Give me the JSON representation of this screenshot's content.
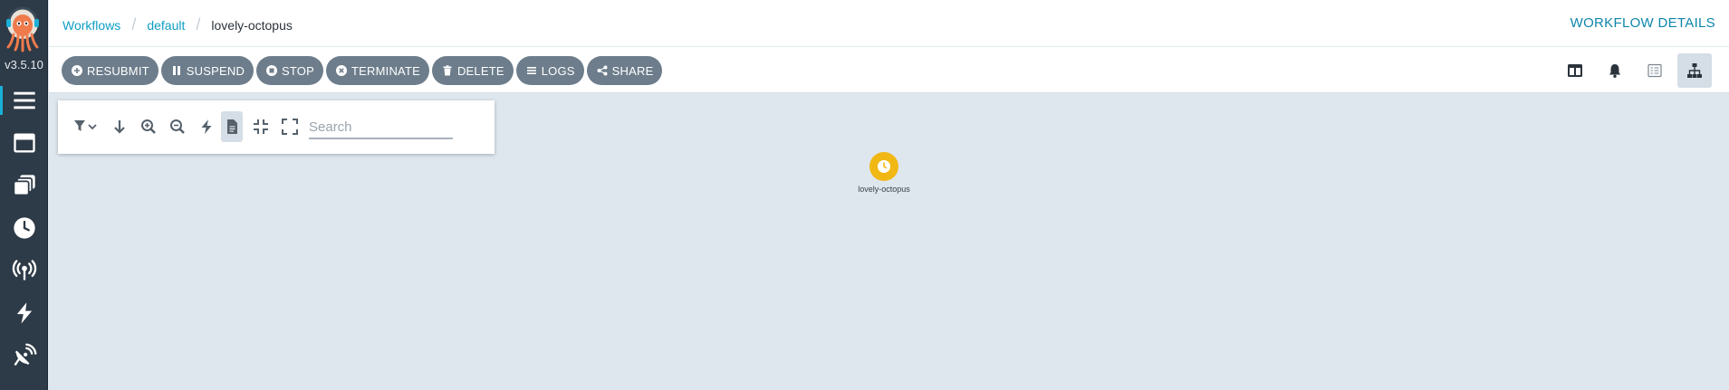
{
  "app": {
    "version": "v3.5.10",
    "accent_color": "#0e9dc4",
    "nav_items": [
      {
        "icon": "hamburger-icon",
        "label": "Workflows"
      },
      {
        "icon": "window-icon",
        "label": "Workflow Templates"
      },
      {
        "icon": "stack-icon",
        "label": "Cluster Workflow Templates"
      },
      {
        "icon": "clock-icon",
        "label": "Cron Workflows"
      },
      {
        "icon": "broadcast-icon",
        "label": "Event Flow"
      },
      {
        "icon": "bolt-icon",
        "label": "Event Sources"
      },
      {
        "icon": "satellite-dish-icon",
        "label": "Sensors"
      }
    ]
  },
  "header": {
    "breadcrumbs": [
      "Workflows",
      "default"
    ],
    "current": "lovely-octopus",
    "title": "WORKFLOW DETAILS"
  },
  "toolbar": {
    "actions": [
      {
        "label": "RESUBMIT",
        "icon": "plus-circle-icon"
      },
      {
        "label": "SUSPEND",
        "icon": "pause-icon"
      },
      {
        "label": "STOP",
        "icon": "stop-circle-icon"
      },
      {
        "label": "TERMINATE",
        "icon": "times-circle-icon"
      },
      {
        "label": "DELETE",
        "icon": "trash-icon"
      },
      {
        "label": "LOGS",
        "icon": "bars-icon"
      },
      {
        "label": "SHARE",
        "icon": "share-icon"
      }
    ],
    "view_buttons": [
      {
        "icon": "columns-icon",
        "active": false
      },
      {
        "icon": "bell-icon",
        "active": false
      },
      {
        "icon": "list-icon",
        "active": false
      },
      {
        "icon": "sitemap-icon",
        "active": true
      }
    ]
  },
  "graph_panel": {
    "search_placeholder": "Search"
  },
  "graph": {
    "nodes": [
      {
        "label": "lovely-octopus",
        "status": "pending",
        "color": "#f1b814"
      }
    ]
  }
}
